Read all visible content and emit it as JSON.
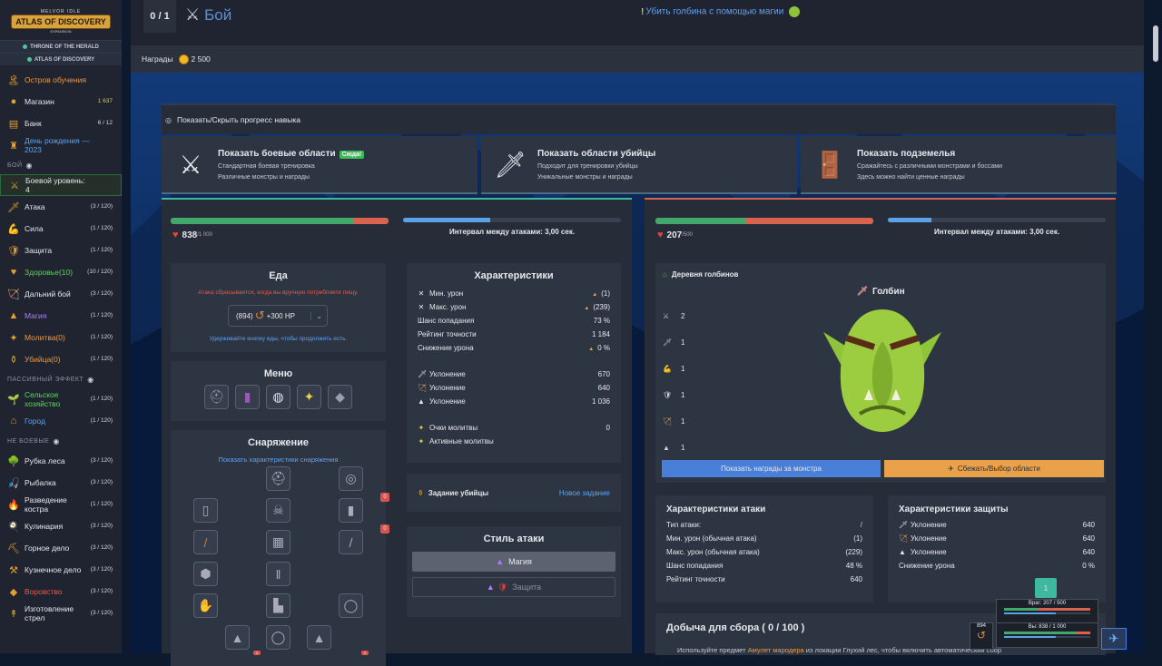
{
  "logo": {
    "top": "MELVOR IDLE",
    "main": "ATLAS OF DISCOVERY",
    "sub": "EXPANSION"
  },
  "expansions": [
    "THRONE OF THE HERALD",
    "ATLAS OF DISCOVERY"
  ],
  "sidebar": {
    "top_items": [
      {
        "icon": "island-icon",
        "glyph": "🏝",
        "label": "Остров обучения",
        "count": "",
        "color": "orange"
      },
      {
        "icon": "shop-icon",
        "glyph": "●",
        "label": "Магазин",
        "count": "1 637",
        "color": ""
      },
      {
        "icon": "bank-icon",
        "glyph": "▤",
        "label": "Банк",
        "count": "6 / 12",
        "color": ""
      },
      {
        "icon": "birthday-icon",
        "glyph": "♜",
        "label": "День рождения — 2023",
        "count": "",
        "color": "blue"
      }
    ],
    "combat_head": "БОЙ",
    "combat_items": [
      {
        "icon": "combat-level-icon",
        "glyph": "⚔",
        "label": "Боевой уровень: 4",
        "count": "",
        "color": "",
        "hl": true
      },
      {
        "icon": "attack-icon",
        "glyph": "🗡",
        "label": "Атака",
        "count": "(3 / 120)",
        "color": ""
      },
      {
        "icon": "strength-icon",
        "glyph": "💪",
        "label": "Сила",
        "count": "(1 / 120)",
        "color": ""
      },
      {
        "icon": "defence-icon",
        "glyph": "🛡",
        "label": "Защита",
        "count": "(1 / 120)",
        "color": ""
      },
      {
        "icon": "hitpoints-icon",
        "glyph": "♥",
        "label": "Здоровье(10)",
        "count": "(10 / 120)",
        "color": "green"
      },
      {
        "icon": "ranged-icon",
        "glyph": "🏹",
        "label": "Дальний бой",
        "count": "(3 / 120)",
        "color": ""
      },
      {
        "icon": "magic-icon",
        "glyph": "▲",
        "label": "Магия",
        "count": "(1 / 120)",
        "color": "purple"
      },
      {
        "icon": "prayer-icon",
        "glyph": "✦",
        "label": "Молитва(0)",
        "count": "(1 / 120)",
        "color": "orange"
      },
      {
        "icon": "slayer-icon",
        "glyph": "⚱",
        "label": "Убийца(0)",
        "count": "(1 / 120)",
        "color": "orange"
      }
    ],
    "passive_head": "ПАССИВНЫЙ ЭФФЕКТ",
    "passive_items": [
      {
        "icon": "farming-icon",
        "glyph": "🌱",
        "label": "Сельское хозяйство",
        "count": "(1 / 120)",
        "color": "green"
      },
      {
        "icon": "town-icon",
        "glyph": "⌂",
        "label": "Город",
        "count": "(1 / 120)",
        "color": "blue"
      }
    ],
    "noncombat_head": "НЕ БОЕВЫЕ",
    "noncombat_items": [
      {
        "icon": "woodcutting-icon",
        "glyph": "🌳",
        "label": "Рубка леса",
        "count": "(3 / 120)",
        "color": ""
      },
      {
        "icon": "fishing-icon",
        "glyph": "🎣",
        "label": "Рыбалка",
        "count": "(3 / 120)",
        "color": ""
      },
      {
        "icon": "firemaking-icon",
        "glyph": "🔥",
        "label": "Разведение костра",
        "count": "(1 / 120)",
        "color": ""
      },
      {
        "icon": "cooking-icon",
        "glyph": "🍳",
        "label": "Кулинария",
        "count": "(3 / 120)",
        "color": ""
      },
      {
        "icon": "mining-icon",
        "glyph": "⛏",
        "label": "Горное дело",
        "count": "(3 / 120)",
        "color": ""
      },
      {
        "icon": "smithing-icon",
        "glyph": "⚒",
        "label": "Кузнечное дело",
        "count": "(3 / 120)",
        "color": ""
      },
      {
        "icon": "thieving-icon",
        "glyph": "◆",
        "label": "Воровство",
        "count": "(3 / 120)",
        "color": "red"
      },
      {
        "icon": "fletching-icon",
        "glyph": "↟",
        "label": "Изготовление стрел",
        "count": "(3 / 120)",
        "color": ""
      }
    ]
  },
  "topbar": {
    "kills": "0 / 1",
    "title": "Бой",
    "quest": "Убить голбина с помощью магии",
    "rewards_label": "Награды",
    "rewards_amount": "2 500"
  },
  "toggle_progress": "Показать/Скрыть прогресс навыка",
  "areas": [
    {
      "icon": "combat-areas-icon",
      "glyph": "⚔",
      "title": "Показать боевые области",
      "badge": "Сюда!",
      "line1": "Стандартная боевая тренировка",
      "line2": "Различные монстры и награды"
    },
    {
      "icon": "slayer-areas-icon",
      "glyph": "🗡",
      "title": "Показать области убийцы",
      "badge": "",
      "line1": "Подходит для тренировки убийцы",
      "line2": "Уникальные монстры и награды"
    },
    {
      "icon": "dungeons-icon",
      "glyph": "🚪",
      "title": "Показать подземелья",
      "badge": "",
      "line1": "Сражайтесь с различными монстрами и боссами",
      "line2": "Здесь можно найти ценные награды"
    }
  ],
  "player": {
    "hp_cur": "838",
    "hp_max": "/1 000",
    "hp_fraction": 0.838,
    "attack_interval": "Интервал между атаками: 3,00 сек.",
    "interval_progress": 0.4
  },
  "food": {
    "title": "Еда",
    "warning": "Атака сбрасывается, когда вы вручную потребляете пищу.",
    "qty": "(894)",
    "heal": "+300 HP",
    "hint": "Удерживайте кнопку еды, чтобы продолжить есть."
  },
  "menu": {
    "title": "Меню",
    "icons": [
      "helmet-icon",
      "spellbook-icon",
      "orb-icon",
      "prayer-star-icon",
      "wolf-icon"
    ]
  },
  "equipment": {
    "title": "Снаряжение",
    "link": "Показать характеристики снаряжения",
    "badge1": "0",
    "badge2": "0",
    "badge3": "0",
    "badge4": "0",
    "slots": [
      "cape-icon",
      "helmet-slot-icon",
      "amulet-slot-icon",
      "body-slot-icon",
      "skull-slot-icon",
      "quiver-slot-icon",
      "staff-slot-icon",
      "platebody-slot-icon",
      "wand-slot-icon",
      "shield-slot-icon",
      "legs-slot-icon",
      "gloves-slot-icon",
      "boots-slot-icon",
      "ring-slot-icon",
      "summon1-slot-icon",
      "wreath-slot-icon",
      "summon2-slot-icon"
    ]
  },
  "stats": {
    "title": "Характеристики",
    "rows": [
      {
        "icon": "min-hit-icon",
        "glyph": "✕",
        "label": "Мин. урон",
        "val": "(1)",
        "tri": true
      },
      {
        "icon": "max-hit-icon",
        "glyph": "✕",
        "label": "Макс. урон",
        "val": "(239)",
        "tri": true
      },
      {
        "icon": "",
        "glyph": "",
        "label": "Шанс попадания",
        "val": "73 %",
        "tri": false
      },
      {
        "icon": "",
        "glyph": "",
        "label": "Рейтинг точности",
        "val": "1 184",
        "tri": false
      },
      {
        "icon": "",
        "glyph": "",
        "label": "Снижение урона",
        "val": "0 %",
        "tri": true
      }
    ],
    "evasion": [
      {
        "icon": "melee-evasion-icon",
        "glyph": "🗡",
        "label": "Уклонение",
        "val": "670"
      },
      {
        "icon": "ranged-evasion-icon",
        "glyph": "🏹",
        "label": "Уклонение",
        "val": "640"
      },
      {
        "icon": "magic-evasion-icon",
        "glyph": "▲",
        "label": "Уклонение",
        "val": "1 036"
      }
    ],
    "prayer": [
      {
        "icon": "prayer-points-icon",
        "glyph": "✦",
        "label": "Очки молитвы",
        "val": "0"
      },
      {
        "icon": "active-prayers-icon",
        "glyph": "✦",
        "label": "Активные молитвы",
        "val": ""
      }
    ]
  },
  "slayer_task": {
    "label": "Задание убийцы",
    "link": "Новое задание"
  },
  "attack_style": {
    "title": "Стиль атаки",
    "magic": "Магия",
    "defence": "Защита"
  },
  "enemy": {
    "hp_cur": "207",
    "hp_max": "/500",
    "hp_fraction": 0.414,
    "attack_interval": "Интервал между атаками: 3,00 сек.",
    "interval_progress": 0.2,
    "area": "Деревня голбинов",
    "name": "Голбин",
    "combat_stats": [
      {
        "icon": "combat-level-icon",
        "glyph": "⚔",
        "val": "2"
      },
      {
        "icon": "attack-level-icon",
        "glyph": "🗡",
        "val": "1"
      },
      {
        "icon": "strength-level-icon",
        "glyph": "💪",
        "val": "1"
      },
      {
        "icon": "defence-level-icon",
        "glyph": "🛡",
        "val": "1"
      },
      {
        "icon": "ranged-level-icon",
        "glyph": "🏹",
        "val": "1"
      },
      {
        "icon": "magic-level-icon",
        "glyph": "▲",
        "val": "1"
      }
    ],
    "btn_drops": "Показать награды за монстра",
    "btn_run": "Сбежать/Выбор области"
  },
  "enemy_attack": {
    "title": "Характеристики атаки",
    "rows": [
      {
        "label": "Тип атаки:",
        "val": ""
      },
      {
        "label": "Мин. урон (обычная атака)",
        "val": "(1)"
      },
      {
        "label": "Макс. урон (обычная атака)",
        "val": "(229)"
      },
      {
        "label": "Шанс попадания",
        "val": "48 %"
      },
      {
        "label": "Рейтинг точности",
        "val": "640"
      }
    ]
  },
  "enemy_defence": {
    "title": "Характеристики защиты",
    "rows": [
      {
        "icon": "melee-evasion-icon",
        "glyph": "🗡",
        "label": "Уклонение",
        "val": "640"
      },
      {
        "icon": "ranged-evasion-icon",
        "glyph": "🏹",
        "label": "Уклонение",
        "val": "640"
      },
      {
        "icon": "magic-evasion-icon",
        "glyph": "▲",
        "label": "Уклонение",
        "val": "640"
      },
      {
        "icon": "",
        "glyph": "",
        "label": "Снижение урона",
        "val": "0 %"
      }
    ]
  },
  "loot": {
    "title": "Добыча для сбора ( 0 / 100 )",
    "hint_a": "Используйте предмет",
    "hint_link": "Амулет мародера",
    "hint_b": "из локации Глухий лес, чтобы включить автоматический сбор"
  },
  "mini": {
    "level": "1",
    "enemy": "Враг: 207 / 500",
    "you": "Вы: 838 / 1 000",
    "food_qty": "894"
  },
  "colors": {
    "hp_green": "#43a86b",
    "hp_red": "#d9634f",
    "accent_blue": "#4a7fd9",
    "accent_orange": "#e9a14a"
  }
}
